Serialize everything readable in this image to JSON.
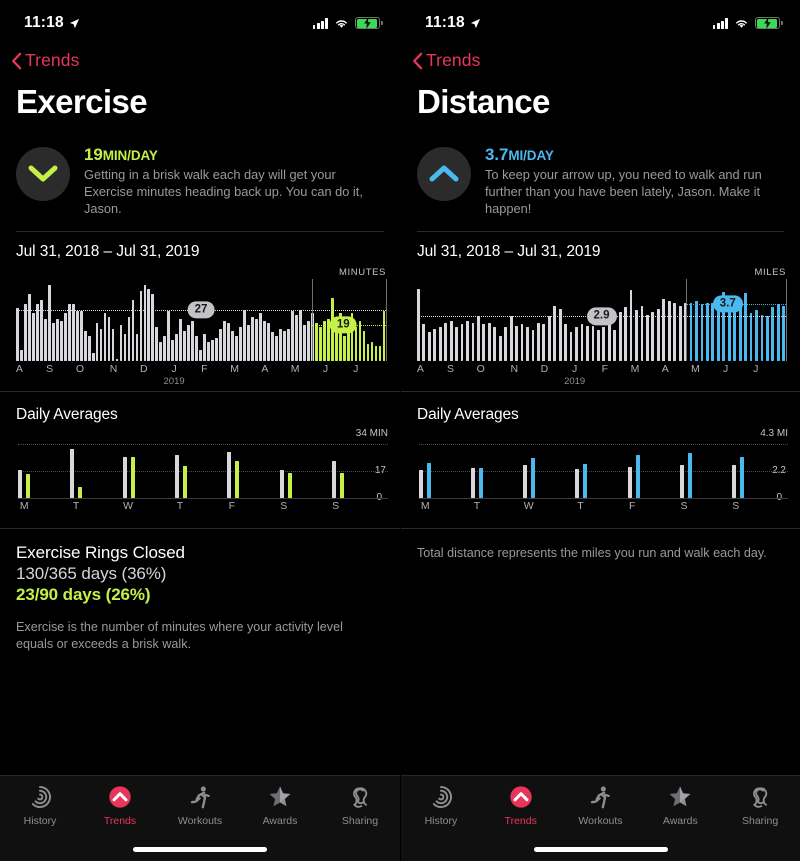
{
  "status_bar": {
    "time": "11:18",
    "location_icon": "location-arrow-icon",
    "cellular_icon": "cellular-bars-icon",
    "wifi_icon": "wifi-icon",
    "battery_icon": "battery-charging-icon"
  },
  "colors": {
    "accent_red": "#e8355a",
    "exercise_green": "#c5f048",
    "distance_blue": "#49b9ef",
    "gray_bar": "#d8d8dc",
    "background": "#000000"
  },
  "panels": [
    {
      "back_label": "Trends",
      "title": "Exercise",
      "trend": {
        "direction_icon": "chevron-down-icon",
        "value": "19",
        "unit": "MIN/DAY",
        "description": "Getting in a brisk walk each day will get your Exercise minutes heading back up. You can do it, Jason.",
        "color": "#c5f048"
      },
      "date_range": "Jul 31, 2018 – Jul 31, 2019",
      "daily_averages_title": "Daily Averages",
      "rings": {
        "title": "Exercise Rings Closed",
        "line1": "130/365 days (36%)",
        "line2": "23/90 days (26%)"
      },
      "footnote": "Exercise is the number of minutes where your activity level equals or exceeds a brisk walk.",
      "chart_data": {
        "type": "bar",
        "title": "Exercise minutes trend",
        "unit_label": "MINUTES",
        "xlabel": "",
        "ylabel": "MINUTES",
        "year_label": "2019",
        "ylim": [
          0,
          42
        ],
        "grid": false,
        "annotations": [
          {
            "label": "27",
            "value": 27,
            "series": "long-term average",
            "color": "#c3c3c7",
            "x_index": 36
          },
          {
            "label": "19",
            "value": 19,
            "series": "90-day average",
            "color": "#c5f048",
            "x_index": 89
          }
        ],
        "tick_labels": [
          "A",
          "S",
          "O",
          "N",
          "D",
          "J",
          "F",
          "M",
          "A",
          "M",
          "J",
          "J"
        ],
        "tick_positions": [
          1,
          10,
          19,
          29,
          38,
          47,
          56,
          65,
          74,
          83,
          92,
          101
        ],
        "series": [
          {
            "name": "365-day window",
            "color": "#d8d8dc",
            "values": [
              28,
              6,
              30,
              35,
              25,
              30,
              32,
              22,
              40,
              20,
              22,
              21,
              25,
              30,
              30,
              26,
              26,
              16,
              13,
              4,
              20,
              17,
              25,
              23,
              17,
              0.5,
              19,
              14,
              23,
              32,
              14,
              37,
              40,
              38,
              35,
              18,
              10,
              13,
              26,
              11,
              14,
              22,
              16,
              19,
              21,
              13,
              6,
              14,
              10,
              11,
              12,
              17,
              21,
              20,
              16,
              13,
              18,
              27,
              19,
              23,
              22,
              25,
              21,
              20,
              15,
              13,
              17,
              16,
              17,
              26,
              24,
              27,
              19,
              21,
              25
            ]
          },
          {
            "name": "90-day window",
            "color": "#c5f048",
            "values": [
              20,
              18,
              21,
              22,
              33,
              17,
              25,
              13,
              21,
              25,
              18,
              21,
              16,
              9,
              10,
              8,
              8,
              26
            ]
          }
        ]
      },
      "daily_averages_chart": {
        "type": "bar",
        "title": "Daily Averages",
        "top_label": "34 MIN",
        "mid_label": "17",
        "bottom_label": "0",
        "ylim": [
          0,
          34
        ],
        "categories": [
          "M",
          "T",
          "W",
          "T",
          "F",
          "S",
          "S"
        ],
        "series": [
          {
            "name": "365-day average",
            "color": "#d8d8dc",
            "values": [
              17.5,
              31,
              26,
              27,
              29,
              17.5,
              23
            ]
          },
          {
            "name": "90-day average",
            "color": "#c5f048",
            "values": [
              15,
              7,
              26,
              20,
              23,
              15.5,
              16
            ]
          }
        ]
      }
    },
    {
      "back_label": "Trends",
      "title": "Distance",
      "trend": {
        "direction_icon": "chevron-up-icon",
        "value": "3.7",
        "unit": "MI/DAY",
        "description": "To keep your arrow up, you need to walk and run further than you have been lately, Jason. Make it happen!",
        "color": "#49b9ef"
      },
      "date_range": "Jul 31, 2018 – Jul 31, 2019",
      "daily_averages_title": "Daily Averages",
      "rings": null,
      "footnote": "Total distance represents the miles you run and walk each day.",
      "chart_data": {
        "type": "bar",
        "title": "Distance trend",
        "unit_label": "MILES",
        "xlabel": "",
        "ylabel": "MILES",
        "year_label": "2019",
        "ylim": [
          0,
          5.2
        ],
        "grid": false,
        "annotations": [
          {
            "label": "2.9",
            "value": 2.9,
            "series": "long-term average",
            "color": "#c3c3c7",
            "x_index": 36
          },
          {
            "label": "3.7",
            "value": 3.7,
            "series": "90-day average",
            "color": "#49b9ef",
            "x_index": 89
          }
        ],
        "tick_labels": [
          "A",
          "S",
          "O",
          "N",
          "D",
          "J",
          "F",
          "M",
          "A",
          "M",
          "J",
          "J"
        ],
        "tick_positions": [
          1,
          10,
          19,
          29,
          38,
          47,
          56,
          65,
          74,
          83,
          92,
          101
        ],
        "series": [
          {
            "name": "365-day window",
            "color": "#d8d8dc",
            "values": [
              4.7,
              2.4,
              1.9,
              2.1,
              2.2,
              2.5,
              2.6,
              2.2,
              2.4,
              2.6,
              2.5,
              2.9,
              2.4,
              2.5,
              2.2,
              1.6,
              2.2,
              2.9,
              2.3,
              2.4,
              2.2,
              2.0,
              2.5,
              2.4,
              2.9,
              3.6,
              3.4,
              2.4,
              1.9,
              2.2,
              2.4,
              2.3,
              2.3,
              2.0,
              2.2,
              2.6,
              2.0,
              3.2,
              3.5,
              4.6,
              3.3,
              3.6,
              3.0,
              3.2,
              3.4,
              4.0,
              3.9,
              3.8,
              3.6,
              3.8
            ]
          },
          {
            "name": "90-day window",
            "color": "#49b9ef",
            "values": [
              3.8,
              3.9,
              3.7,
              3.8,
              3.8,
              3.9,
              4.5,
              3.7,
              3.9,
              3.8,
              4.4,
              3.1,
              3.3,
              3.0,
              2.9,
              3.5,
              3.7,
              3.6
            ]
          }
        ]
      },
      "daily_averages_chart": {
        "type": "bar",
        "title": "Daily Averages",
        "top_label": "4.3 MI",
        "mid_label": "2.2",
        "bottom_label": "0",
        "ylim": [
          0,
          4.3
        ],
        "categories": [
          "M",
          "T",
          "W",
          "T",
          "F",
          "S",
          "S"
        ],
        "series": [
          {
            "name": "365-day average",
            "color": "#d8d8dc",
            "values": [
              2.2,
              2.4,
              2.6,
              2.3,
              2.5,
              2.6,
              2.6
            ]
          },
          {
            "name": "90-day average",
            "color": "#49b9ef",
            "values": [
              2.8,
              2.4,
              3.2,
              2.7,
              3.4,
              3.6,
              3.3
            ]
          }
        ]
      }
    }
  ],
  "tab_bar": {
    "items": [
      {
        "label": "History",
        "icon": "rings-history-icon",
        "active": false
      },
      {
        "label": "Trends",
        "icon": "trends-up-arrow-icon",
        "active": true
      },
      {
        "label": "Workouts",
        "icon": "running-person-icon",
        "active": false
      },
      {
        "label": "Awards",
        "icon": "star-award-icon",
        "active": false
      },
      {
        "label": "Sharing",
        "icon": "sharing-figures-icon",
        "active": false
      }
    ]
  }
}
